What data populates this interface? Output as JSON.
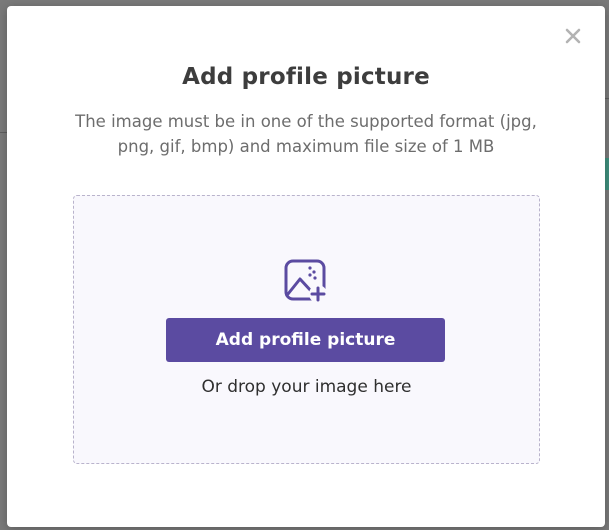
{
  "modal": {
    "title": "Add profile picture",
    "description": "The image must be in one of the supported format (jpg, png, gif, bmp) and maximum file size of 1 MB",
    "close_icon": "close-icon"
  },
  "dropzone": {
    "icon": "add-image-icon",
    "button_label": "Add profile picture",
    "drop_hint": "Or drop your image here"
  },
  "colors": {
    "accent": "#5b4ba1",
    "title_text": "#3d3d3d",
    "description_text": "#6d6d6d",
    "dropzone_border": "#b9b3cc",
    "dropzone_background": "#f9f8fd"
  }
}
